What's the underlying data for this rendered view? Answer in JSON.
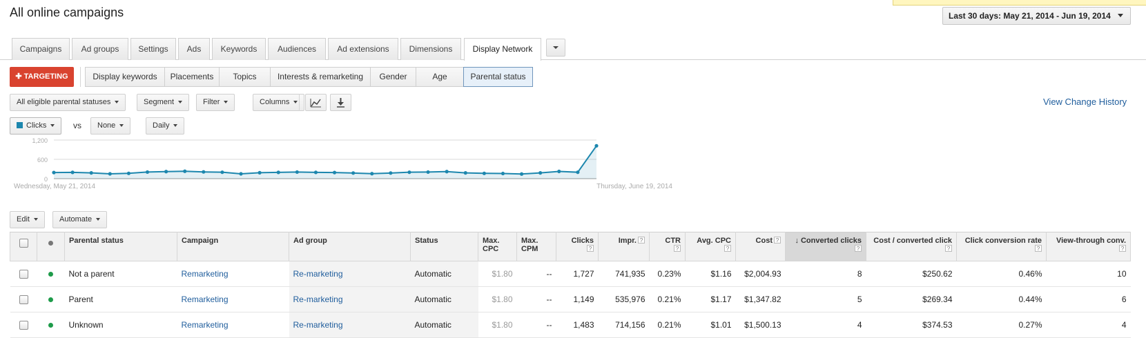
{
  "header": {
    "title": "All online campaigns",
    "date_range": "Last 30 days: May 21, 2014 - Jun 19, 2014"
  },
  "tabs": [
    {
      "label": "Campaigns"
    },
    {
      "label": "Ad groups"
    },
    {
      "label": "Settings"
    },
    {
      "label": "Ads"
    },
    {
      "label": "Keywords"
    },
    {
      "label": "Audiences"
    },
    {
      "label": "Ad extensions"
    },
    {
      "label": "Dimensions"
    },
    {
      "label": "Display Network"
    }
  ],
  "targeting_button": "TARGETING",
  "targeting_tabs": [
    {
      "label": "Display keywords"
    },
    {
      "label": "Placements"
    },
    {
      "label": "Topics"
    },
    {
      "label": "Interests & remarketing"
    },
    {
      "label": "Gender"
    },
    {
      "label": "Age"
    },
    {
      "label": "Parental status"
    }
  ],
  "toolbar": {
    "status_filter": "All eligible parental statuses",
    "segment": "Segment",
    "filter": "Filter",
    "columns": "Columns",
    "view_history": "View Change History"
  },
  "chart_controls": {
    "metric": "Clicks",
    "vs": "vs",
    "compare": "None",
    "granularity": "Daily"
  },
  "chart_data": {
    "type": "line",
    "title": "",
    "series": [
      {
        "name": "Clicks",
        "values": [
          190,
          195,
          180,
          150,
          165,
          205,
          220,
          230,
          210,
          200,
          150,
          185,
          195,
          205,
          195,
          190,
          175,
          155,
          175,
          200,
          205,
          220,
          180,
          165,
          160,
          145,
          180,
          225,
          200,
          1020
        ]
      }
    ],
    "x_start_label": "Wednesday, May 21, 2014",
    "x_end_label": "Thursday, June 19, 2014",
    "y_ticks": [
      "1,200",
      "600",
      "0"
    ],
    "ylim": [
      0,
      1200
    ],
    "color": "#1d87ae",
    "grid": true
  },
  "actions": {
    "edit": "Edit",
    "automate": "Automate"
  },
  "table": {
    "columns": [
      {
        "label": "Parental status"
      },
      {
        "label": "Campaign"
      },
      {
        "label": "Ad group"
      },
      {
        "label": "Status"
      },
      {
        "label": "Max. CPC"
      },
      {
        "label": "Max. CPM"
      },
      {
        "label": "Clicks"
      },
      {
        "label": "Impr."
      },
      {
        "label": "CTR"
      },
      {
        "label": "Avg. CPC"
      },
      {
        "label": "Cost"
      },
      {
        "label": "Converted clicks"
      },
      {
        "label": "Cost / converted click"
      },
      {
        "label": "Click conversion rate"
      },
      {
        "label": "View-through conv."
      }
    ],
    "help_glyph": "?",
    "sort_glyph": "↓",
    "rows": [
      {
        "parental_status": "Not a parent",
        "campaign": "Remarketing",
        "ad_group": "Re-marketing",
        "status": "Automatic",
        "max_cpc": "$1.80",
        "max_cpm": "--",
        "clicks": "1,727",
        "impr": "741,935",
        "ctr": "0.23%",
        "avg_cpc": "$1.16",
        "cost": "$2,004.93",
        "converted_clicks": "8",
        "cost_per_conv": "$250.62",
        "conv_rate": "0.46%",
        "view_through": "10"
      },
      {
        "parental_status": "Parent",
        "campaign": "Remarketing",
        "ad_group": "Re-marketing",
        "status": "Automatic",
        "max_cpc": "$1.80",
        "max_cpm": "--",
        "clicks": "1,149",
        "impr": "535,976",
        "ctr": "0.21%",
        "avg_cpc": "$1.17",
        "cost": "$1,347.82",
        "converted_clicks": "5",
        "cost_per_conv": "$269.34",
        "conv_rate": "0.44%",
        "view_through": "6"
      },
      {
        "parental_status": "Unknown",
        "campaign": "Remarketing",
        "ad_group": "Re-marketing",
        "status": "Automatic",
        "max_cpc": "$1.80",
        "max_cpm": "--",
        "clicks": "1,483",
        "impr": "714,156",
        "ctr": "0.21%",
        "avg_cpc": "$1.01",
        "cost": "$1,500.13",
        "converted_clicks": "4",
        "cost_per_conv": "$374.53",
        "conv_rate": "0.27%",
        "view_through": "4"
      }
    ]
  }
}
